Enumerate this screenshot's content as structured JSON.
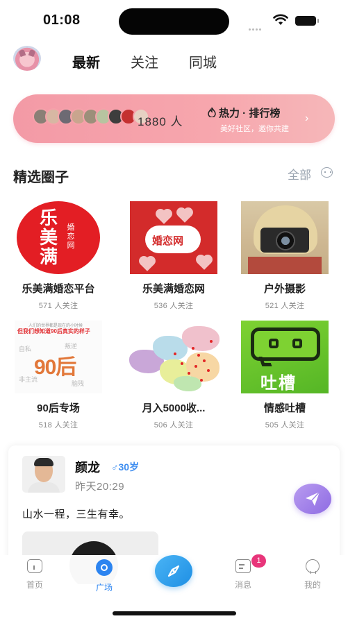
{
  "status_bar": {
    "time": "01:08"
  },
  "header": {
    "tabs": [
      {
        "label": "最新",
        "active": true
      },
      {
        "label": "关注",
        "active": false
      },
      {
        "label": "同城",
        "active": false
      }
    ]
  },
  "ranking": {
    "count": "1880 人",
    "title": "热力 · 排行榜",
    "subtitle": "美好社区，邀你共建",
    "avatar_colors": [
      "#8a7f76",
      "#d7b7a3",
      "#6d6a73",
      "#c9a58e",
      "#9c8f7a",
      "#b7c4a0",
      "#3d3d3d",
      "#c43030",
      "#e6d1c2"
    ]
  },
  "circles_section": {
    "title": "精选圈子",
    "all_label": "全部",
    "items": [
      {
        "name": "乐美满婚恋平台",
        "followers": "571 人关注",
        "logo_big": "乐美满",
        "logo_small": "婚恋网"
      },
      {
        "name": "乐美满婚恋网",
        "followers": "536 人关注",
        "logo_text": "婚恋网"
      },
      {
        "name": "户外摄影",
        "followers": "521 人关注"
      },
      {
        "name": "90后专场",
        "followers": "518 人关注",
        "logo_line1": "人们的世界都是现在的小时候",
        "logo_line2": "但我们想知道90后真实的样子",
        "logo_num": "90后"
      },
      {
        "name": "月入5000收...",
        "followers": "506 人关注"
      },
      {
        "name": "情感吐槽",
        "followers": "505 人关注",
        "logo_text": "吐槽"
      }
    ]
  },
  "feed": {
    "post": {
      "author": "颜龙",
      "gender_age": "♂30岁",
      "time": "昨天20:29",
      "text": "山水一程，三生有幸。"
    }
  },
  "tab_bar": {
    "items": [
      {
        "label": "首页",
        "icon": "home-icon"
      },
      {
        "label": "广场",
        "icon": "square-icon",
        "active": true
      },
      {
        "label": "消息",
        "icon": "message-icon",
        "badge": "1"
      },
      {
        "label": "我的",
        "icon": "profile-icon"
      }
    ]
  },
  "colors": {
    "accent": "#2c84f0",
    "banner_pink": "#f39aa6",
    "badge": "#e8357a",
    "age_blue": "#3f8ef0"
  }
}
